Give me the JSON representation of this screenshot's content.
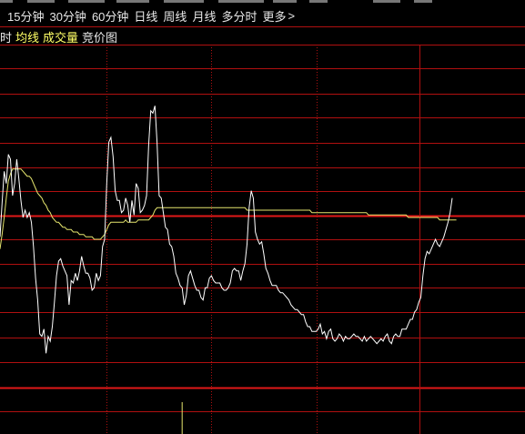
{
  "menu": {
    "items": [
      "15分钟",
      "30分钟",
      "60分钟",
      "日线",
      "周线",
      "月线",
      "多分时",
      "更多"
    ],
    "more_arrow": ">"
  },
  "subbar": {
    "items": [
      {
        "label": "时",
        "color": "#e8e8e8"
      },
      {
        "label": "均线",
        "color": "#ffff66"
      },
      {
        "label": "成交量",
        "color": "#ffff66"
      },
      {
        "label": "竞价图",
        "color": "#e8e8e8"
      }
    ]
  },
  "colors": {
    "grid": "#b01010",
    "grid_bold": "#e01818",
    "price_line": "#ffffff",
    "avg_line": "#e6e66e",
    "volume_bar": "#e6e66e"
  },
  "chart_data": {
    "type": "line",
    "series": [
      {
        "values": [
          52,
          66,
          79,
          74,
          86,
          84,
          69,
          74,
          84,
          76,
          67,
          60,
          63,
          60,
          62,
          58,
          48,
          35,
          26,
          12,
          11,
          14,
          4,
          11,
          9,
          15,
          25,
          36,
          42,
          43,
          40,
          38,
          36,
          24,
          34,
          33,
          37,
          34,
          38,
          44,
          40,
          37,
          37,
          35,
          30,
          31,
          37,
          34,
          36,
          48,
          51,
          74,
          91,
          93,
          85,
          71,
          67,
          67,
          62,
          63,
          68,
          65,
          58,
          67,
          61,
          74,
          72,
          62,
          63,
          65,
          69,
          90,
          104,
          103,
          106,
          91,
          69,
          68,
          62,
          56,
          55,
          49,
          48,
          44,
          37,
          35,
          32,
          31,
          24,
          28,
          36,
          38,
          35,
          32,
          30,
          30,
          27,
          26,
          31,
          31,
          35,
          36,
          34,
          33,
          33,
          33,
          31,
          30,
          30,
          31,
          33,
          38,
          39,
          38,
          38,
          34,
          38,
          41,
          49,
          64,
          71,
          68,
          54,
          51,
          49,
          50,
          45,
          39,
          37,
          34,
          32,
          32,
          32,
          30,
          29,
          29,
          28,
          27,
          26,
          24,
          23,
          22,
          22,
          21,
          20,
          20,
          17,
          15,
          15,
          13,
          13,
          13,
          14,
          16,
          12,
          13,
          10,
          13,
          14,
          10,
          9,
          10,
          12,
          11,
          9,
          11,
          10,
          10,
          11,
          12,
          11,
          11,
          10,
          9,
          11,
          9,
          10,
          11,
          10,
          9,
          8,
          9,
          10,
          9,
          11,
          12,
          9,
          8,
          11,
          12,
          11,
          11,
          14,
          14,
          14,
          16,
          18,
          18,
          21,
          22,
          25,
          27,
          36,
          43,
          46,
          45,
          47,
          49,
          51,
          49,
          48,
          50,
          52,
          55,
          58,
          62,
          68
        ]
      },
      {
        "values": [
          47,
          53,
          60,
          68,
          75,
          78,
          80,
          80,
          80,
          80,
          80,
          79,
          78,
          77,
          77,
          76,
          74,
          72,
          70,
          69,
          68,
          66,
          65,
          63,
          62,
          60,
          59,
          58,
          58,
          57,
          56,
          56,
          55,
          55,
          55,
          54,
          54,
          54,
          53,
          53,
          53,
          52,
          52,
          52,
          52,
          51,
          51,
          51,
          51,
          52,
          53,
          55,
          57,
          58,
          58,
          58,
          58,
          58,
          58,
          58,
          59,
          58,
          58,
          58,
          58,
          58,
          59,
          59,
          59,
          59,
          59,
          59,
          60,
          61,
          63,
          64,
          64,
          64,
          64,
          64,
          64,
          64,
          64,
          64,
          64,
          64,
          64,
          64,
          64,
          64,
          64,
          64,
          64,
          64,
          64,
          64,
          64,
          64,
          64,
          64,
          64,
          64,
          64,
          64,
          64,
          64,
          64,
          64,
          64,
          64,
          64,
          64,
          64,
          64,
          64,
          64,
          64,
          64,
          63,
          63,
          63,
          63,
          63,
          63,
          63,
          63,
          63,
          63,
          63,
          63,
          63,
          63,
          63,
          63,
          63,
          63,
          63,
          63,
          63,
          63,
          63,
          63,
          63,
          63,
          63,
          63,
          63,
          63,
          63,
          62,
          62,
          62,
          62,
          62,
          62,
          62,
          62,
          62,
          62,
          62,
          62,
          62,
          62,
          62,
          62,
          62,
          62,
          62,
          62,
          62,
          62,
          62,
          62,
          62,
          62,
          62,
          61,
          61,
          61,
          61,
          61,
          61,
          61,
          61,
          61,
          61,
          61,
          61,
          61,
          61,
          61,
          61,
          61,
          61,
          61,
          60,
          60,
          60,
          60,
          60,
          60,
          60,
          60,
          60,
          60,
          60,
          60,
          60,
          60,
          60,
          59,
          59,
          59,
          59,
          59,
          59,
          59,
          59,
          59
        ]
      }
    ],
    "volume": [
      {
        "index": 87,
        "value": 100
      }
    ],
    "ylim": [
      0,
      120
    ],
    "grid": true
  }
}
